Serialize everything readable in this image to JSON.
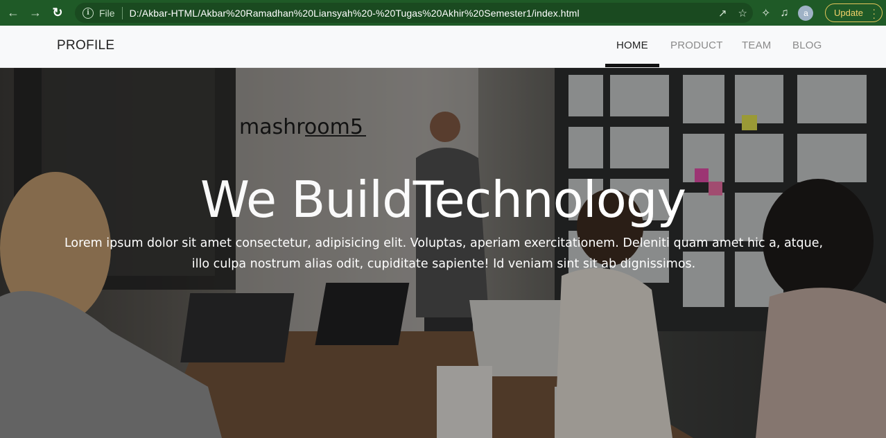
{
  "browser": {
    "file_label": "File",
    "url": "D:/Akbar-HTML/Akbar%20Ramadhan%20Liansyah%20-%20Tugas%20Akhir%20Semester1/index.html",
    "avatar_letter": "a",
    "update_label": "Update",
    "icons": [
      "back-icon",
      "forward-icon",
      "reload-icon",
      "info-icon",
      "share-icon",
      "star-icon",
      "extensions-icon",
      "media-icon",
      "menu-dots-icon"
    ]
  },
  "navbar": {
    "brand": "PROFILE",
    "items": [
      {
        "label": "HOME",
        "active": true
      },
      {
        "label": "PRODUCT",
        "active": false
      },
      {
        "label": "TEAM",
        "active": false
      },
      {
        "label": "BLOG",
        "active": false
      }
    ]
  },
  "hero": {
    "title_part1": "We Build",
    "title_part2": "Technology",
    "text": "Lorem ipsum dolor sit amet consectetur, adipisicing elit. Voluptas, aperiam exercitationem. Deleniti quam amet hic a, atque, illo culpa nostrum alias odit, cupiditate sapiente! Id veniam sint sit ab dignissimos.",
    "background_text": "mashroom5"
  },
  "colors": {
    "chrome_bg": "#1f5a27",
    "update_accent": "#f3d26a",
    "navbar_bg": "#f8f9fa",
    "active_underline": "#111111"
  }
}
